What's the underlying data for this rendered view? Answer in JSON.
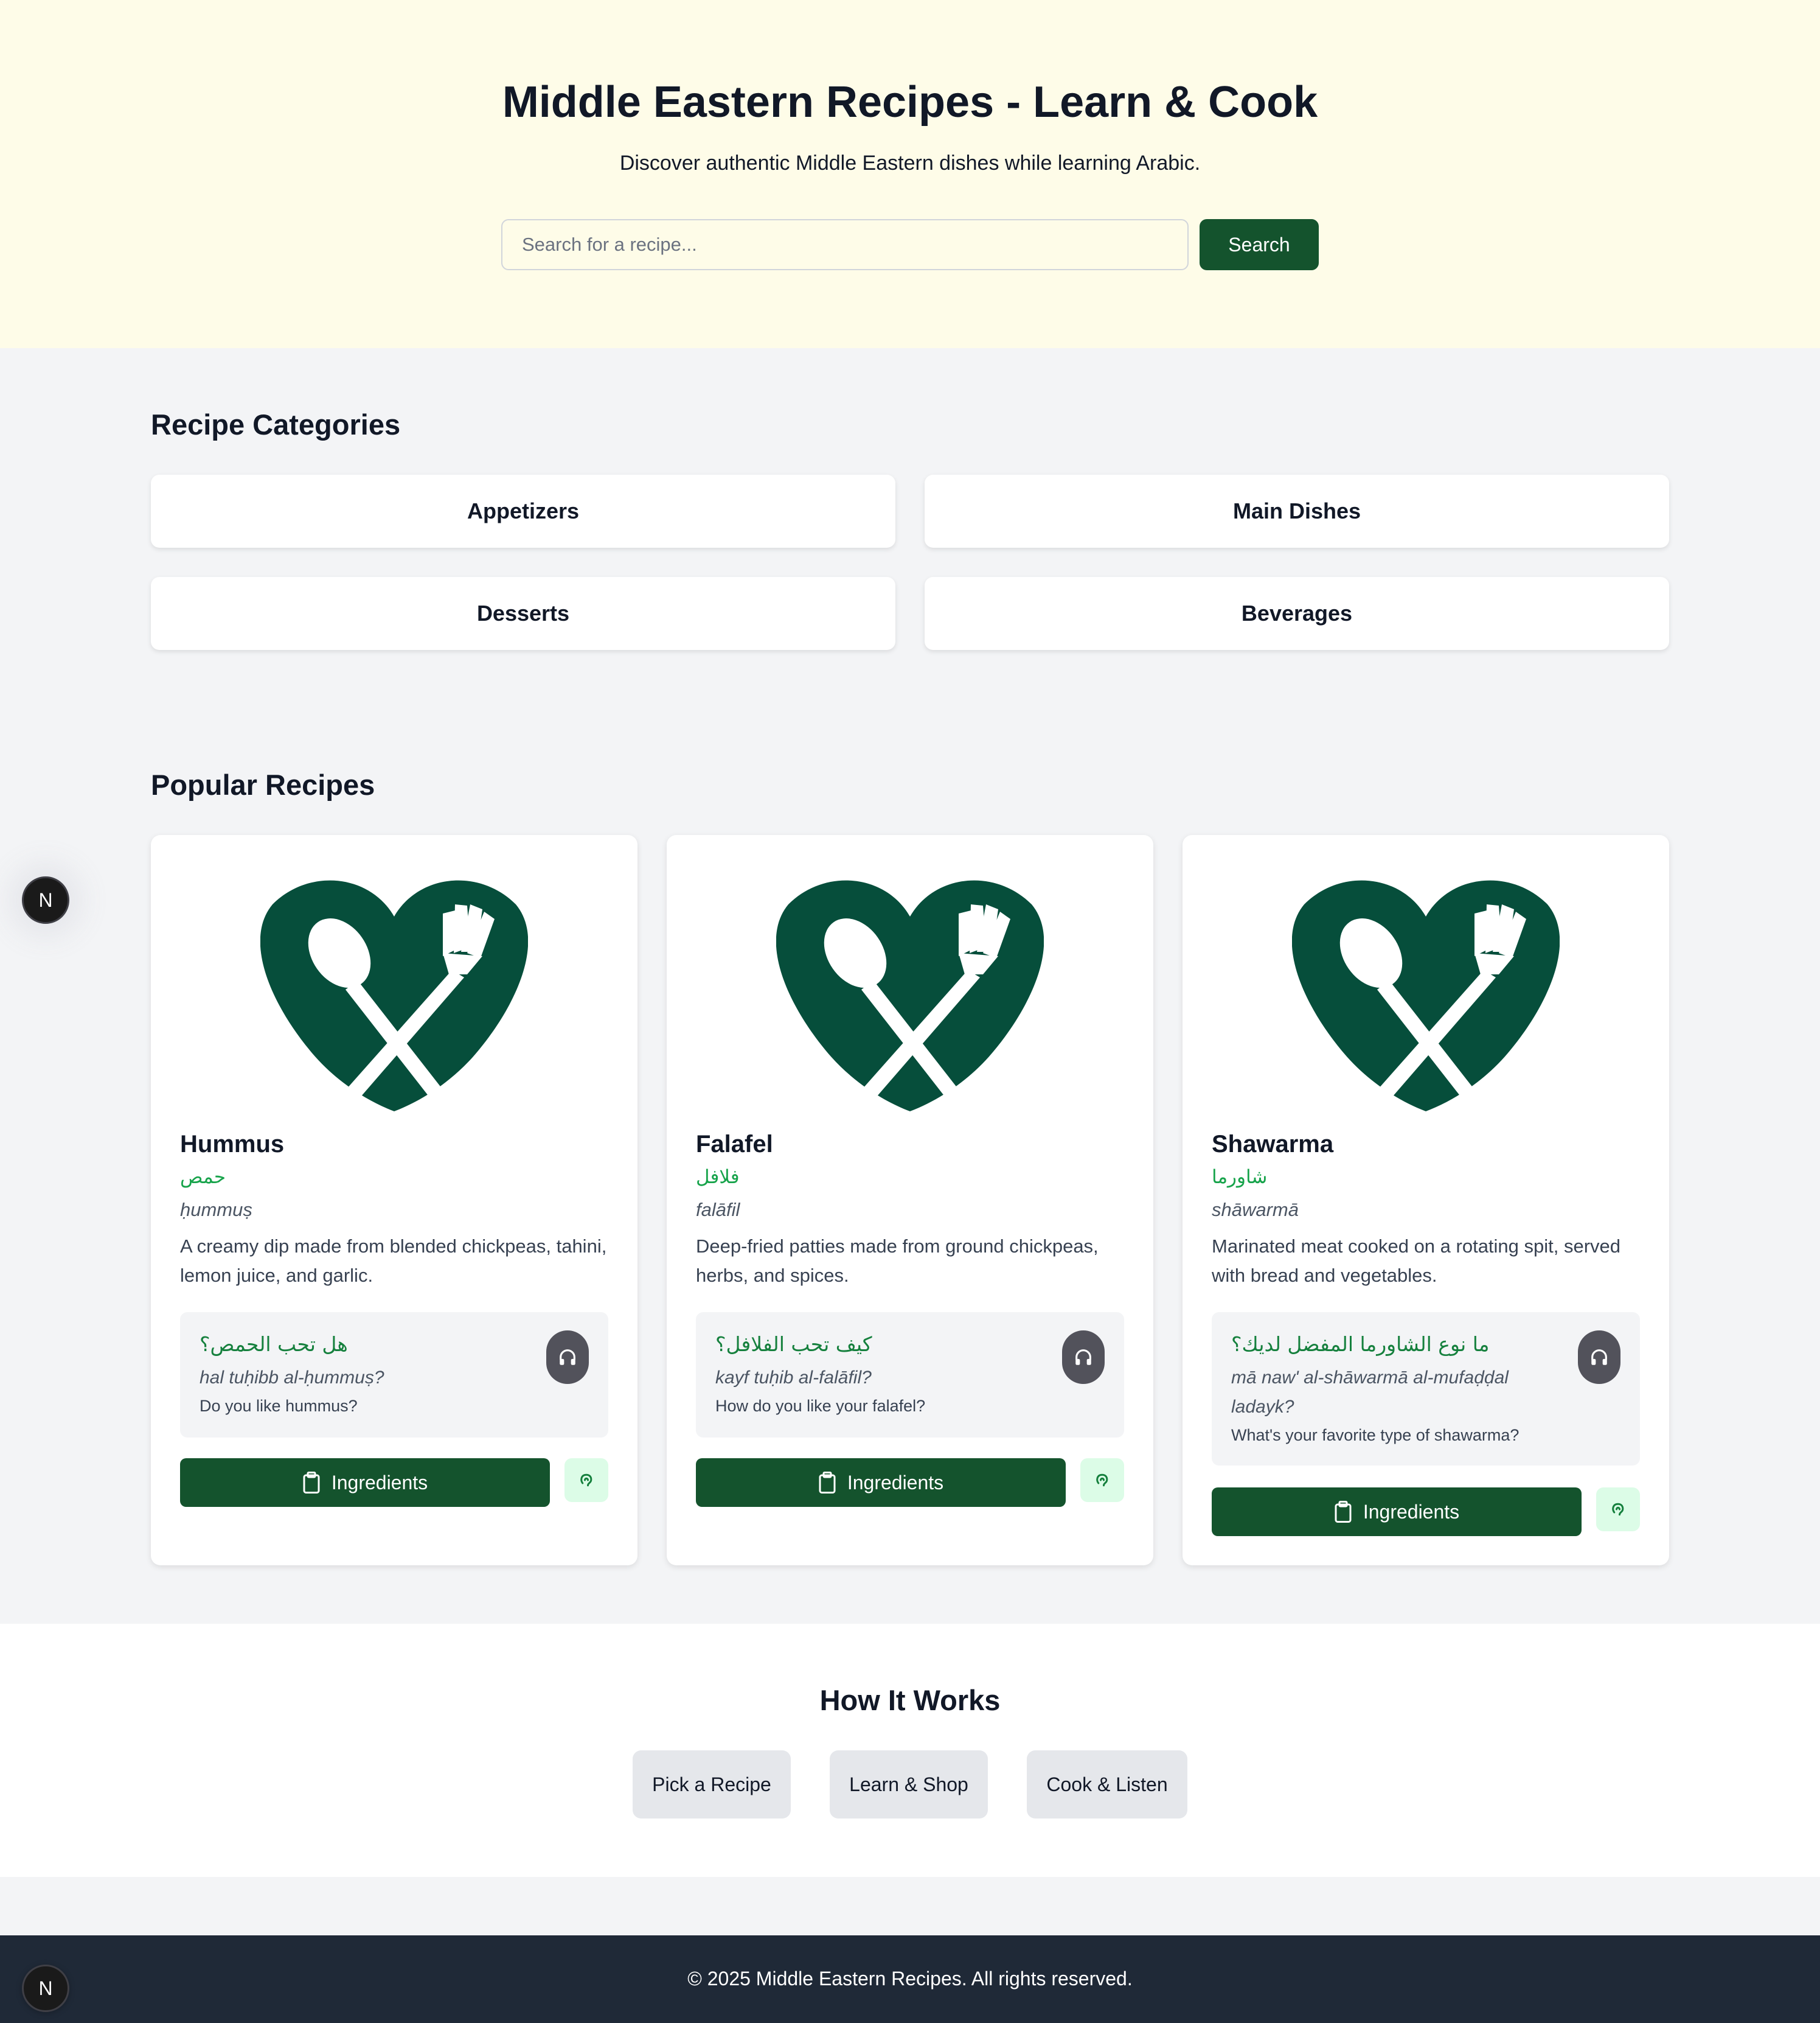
{
  "hero": {
    "title": "Middle Eastern Recipes - Learn & Cook",
    "subtitle": "Discover authentic Middle Eastern dishes while learning Arabic.",
    "search_placeholder": "Search for a recipe...",
    "search_button": "Search"
  },
  "categories": {
    "title": "Recipe Categories",
    "items": [
      "Appetizers",
      "Main Dishes",
      "Desserts",
      "Beverages"
    ]
  },
  "popular": {
    "title": "Popular Recipes",
    "recipes": [
      {
        "name": "Hummus",
        "arabic": "حمص",
        "translit": "ḥummuṣ",
        "description": "A creamy dip made from blended chickpeas, tahini, lemon juice, and garlic.",
        "phrase_arabic": "هل تحب الحمص؟",
        "phrase_translit": "hal tuḥibb al-ḥummuṣ?",
        "phrase_english": "Do you like hummus?",
        "ingredients_label": "Ingredients"
      },
      {
        "name": "Falafel",
        "arabic": "فلافل",
        "translit": "falāfil",
        "description": "Deep-fried patties made from ground chickpeas, herbs, and spices.",
        "phrase_arabic": "كيف تحب الفلافل؟",
        "phrase_translit": "kayf tuḥib al-falāfil?",
        "phrase_english": "How do you like your falafel?",
        "ingredients_label": "Ingredients"
      },
      {
        "name": "Shawarma",
        "arabic": "شاورما",
        "translit": "shāwarmā",
        "description": "Marinated meat cooked on a rotating spit, served with bread and vegetables.",
        "phrase_arabic": "ما نوع الشاورما المفضل لديك؟",
        "phrase_translit": "mā naw' al-shāwarmā al-mufaḍḍal ladayk?",
        "phrase_english": "What's your favorite type of shawarma?",
        "ingredients_label": "Ingredients"
      }
    ]
  },
  "how_it_works": {
    "title": "How It Works",
    "steps": [
      "Pick a Recipe",
      "Learn & Shop",
      "Cook & Listen"
    ]
  },
  "footer": {
    "text": "© 2025 Middle Eastern Recipes. All rights reserved."
  },
  "dev_badge": {
    "label": "N"
  },
  "icons": {
    "recipe_image": "heart-spoon-fork-icon",
    "audio": "headphones-icon",
    "ingredients": "clipboard-icon",
    "speak": "ear-icon",
    "badge": "nextjs-icon"
  },
  "colors": {
    "hero_bg": "#fefce8",
    "primary_green": "#14532d",
    "logo_green": "#064e3b",
    "arabic_green": "#16a34a",
    "footer_bg": "#1f2937",
    "page_bg": "#f3f4f6"
  }
}
